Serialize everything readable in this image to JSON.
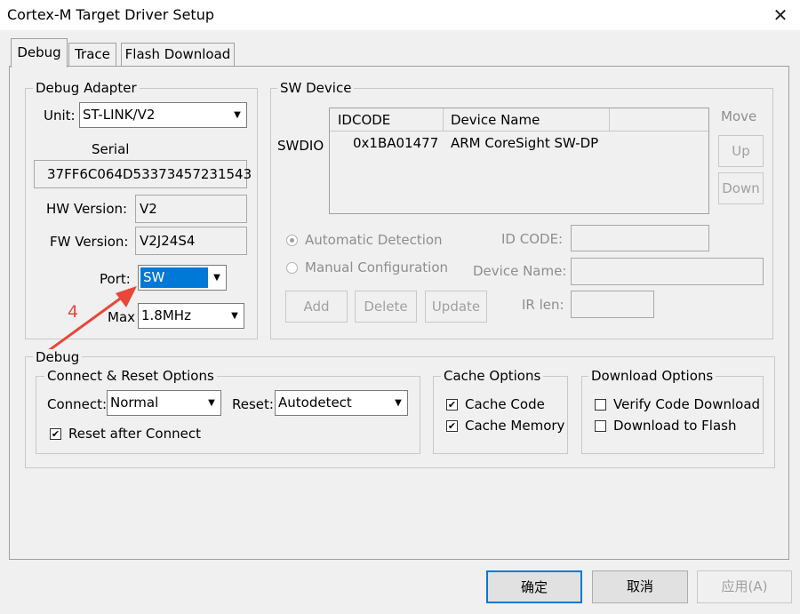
{
  "window": {
    "title": "Cortex-M Target Driver Setup",
    "close_glyph": "✕"
  },
  "tabs": [
    "Debug",
    "Trace",
    "Flash Download"
  ],
  "debug_adapter": {
    "title": "Debug Adapter",
    "unit_label": "Unit:",
    "unit_value": "ST-LINK/V2",
    "serial_label": "Serial",
    "serial_value": "37FF6C064D53373457231543",
    "hw_label": "HW Version:",
    "hw_value": "V2",
    "fw_label": "FW Version:",
    "fw_value": "V2J24S4",
    "port_label": "Port:",
    "port_value": "SW",
    "max_label": "Max",
    "max_value": "1.8MHz"
  },
  "annotation": {
    "number": "4",
    "color": "#e8473a"
  },
  "sw_device": {
    "title": "SW Device",
    "move_label": "Move",
    "up_label": "Up",
    "down_label": "Down",
    "swdio_label": "SWDIO",
    "columns": [
      "IDCODE",
      "Device Name"
    ],
    "rows": [
      {
        "idcode": "0x1BA01477",
        "device_name": "ARM CoreSight SW-DP"
      }
    ],
    "auto_detect_label": "Automatic Detection",
    "manual_config_label": "Manual Configuration",
    "idcode_label": "ID CODE:",
    "device_name_label": "Device Name:",
    "ir_len_label": "IR len:",
    "add_label": "Add",
    "delete_label": "Delete",
    "update_label": "Update"
  },
  "debug_group": {
    "title": "Debug",
    "connect_reset": {
      "title": "Connect & Reset Options",
      "connect_label": "Connect:",
      "connect_value": "Normal",
      "reset_label": "Reset:",
      "reset_value": "Autodetect",
      "reset_after_connect_label": "Reset after Connect",
      "reset_after_connect_checked": true
    },
    "cache": {
      "title": "Cache Options",
      "cache_code_label": "Cache Code",
      "cache_code_checked": true,
      "cache_memory_label": "Cache Memory",
      "cache_memory_checked": true
    },
    "download": {
      "title": "Download Options",
      "verify_label": "Verify Code Download",
      "verify_checked": false,
      "flash_label": "Download to Flash",
      "flash_checked": false
    }
  },
  "footer": {
    "ok_label": "确定",
    "cancel_label": "取消",
    "apply_label": "应用(A)"
  },
  "colors": {
    "selection": "#0078d7",
    "accent_arrow": "#e8473a"
  }
}
